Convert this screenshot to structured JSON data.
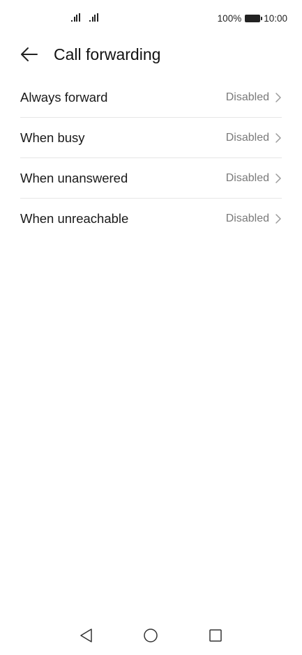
{
  "status_bar": {
    "battery_percent": "100%",
    "time": "10:00",
    "icons": [
      "signal-icon",
      "signal-icon",
      "battery-icon"
    ]
  },
  "header": {
    "title": "Call forwarding",
    "back_icon": "back-arrow-icon"
  },
  "items": [
    {
      "label": "Always forward",
      "status": "Disabled"
    },
    {
      "label": "When busy",
      "status": "Disabled"
    },
    {
      "label": "When unanswered",
      "status": "Disabled"
    },
    {
      "label": "When unreachable",
      "status": "Disabled"
    }
  ],
  "nav_bar": {
    "icons": [
      "nav-back-icon",
      "nav-home-icon",
      "nav-recents-icon"
    ]
  },
  "colors": {
    "text_primary": "#1a1a1a",
    "text_secondary": "#7a7a7a",
    "divider": "#e6e6e6",
    "background": "#ffffff"
  }
}
